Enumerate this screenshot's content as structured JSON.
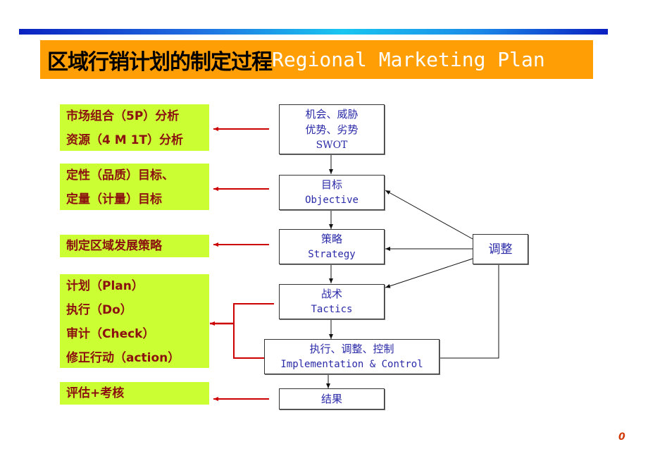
{
  "title": {
    "cn": "区域行销计划的制定过程",
    "en": "Regional Marketing Plan"
  },
  "left_boxes": [
    {
      "lines": [
        "市场组合（5P）分析",
        "资源（4 M 1T）分析"
      ]
    },
    {
      "lines": [
        "定性（品质）目标、",
        "定量（计量）目标"
      ]
    },
    {
      "lines": [
        "制定区域发展策略"
      ]
    },
    {
      "lines": [
        "计划（Plan）",
        "执行（Do）",
        "审计（Check）",
        "修正行动（action）"
      ]
    },
    {
      "lines": [
        "评估+考核"
      ]
    }
  ],
  "flow": {
    "swot": {
      "line1": "机会、威胁",
      "line2": "优势、劣势",
      "line3": "SWOT"
    },
    "objective": {
      "cn": "目标",
      "en": "Objective"
    },
    "strategy": {
      "cn": "策略",
      "en": "Strategy"
    },
    "tactics": {
      "cn": "战术",
      "en": "Tactics"
    },
    "implementation": {
      "cn": "执行、调整、控制",
      "en": "Implementation & Control"
    },
    "result": {
      "cn": "结果"
    },
    "adjust": {
      "cn": "调整"
    }
  },
  "colors": {
    "title_bg": "#ff9e05",
    "left_box_bg": "#ccff33",
    "left_text": "#8b1010",
    "flow_text": "#2a2aa8",
    "arrow_red": "#cc0000"
  },
  "page_number": "0"
}
